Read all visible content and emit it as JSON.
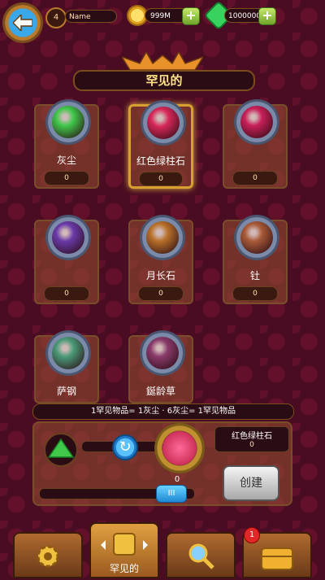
{
  "header": {
    "level": "4",
    "player_name": "Name",
    "coins": "999M",
    "gems": "1000000",
    "plus_label": "+"
  },
  "category": {
    "title": "罕见的"
  },
  "items": [
    {
      "label": "灰尘",
      "count": "0",
      "color": "#3fc84a"
    },
    {
      "label": "红色绿柱石",
      "count": "0",
      "color": "#d8285a"
    },
    {
      "label": "",
      "count": "0",
      "color": "#c82058"
    },
    {
      "label": "",
      "count": "0",
      "color": "#6a3aa8"
    },
    {
      "label": "月长石",
      "count": "0",
      "color": "#b8702a"
    },
    {
      "label": "钍",
      "count": "0",
      "color": "#a85a38"
    },
    {
      "label": "萨钢",
      "count": "",
      "color": "#4a9a78"
    },
    {
      "label": "鋋龄草",
      "count": "",
      "color": "#8a3a6a"
    }
  ],
  "crafting": {
    "formula": "1罕见物品= 1灰尘 · 6灰尘= 1罕见物品",
    "result_name": "红色绿柱石",
    "result_count": "0",
    "target_count": "0",
    "create_label": "创建",
    "slider_label": "III",
    "slider_level": 0.8
  },
  "nav": {
    "tab_active_label": "罕见的",
    "notification_count": "1"
  },
  "colors": {
    "background": "#4a0c22",
    "gold": "#ffe28a",
    "gem_green": "#3fc84a"
  }
}
